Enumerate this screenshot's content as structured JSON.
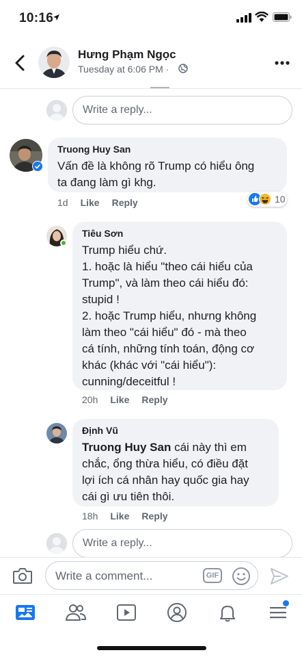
{
  "status": {
    "time": "10:16"
  },
  "header": {
    "name": "Hưng Phạm Ngọc",
    "meta": "Tuesday at 6:06 PM ·"
  },
  "reply_top": {
    "placeholder": "Write a reply..."
  },
  "comments": [
    {
      "name": "Truong Huy San",
      "text": "Vấn đề là không rõ Trump có hiểu ông\nta đang làm gì khg.",
      "time": "1d",
      "like": "Like",
      "reply": "Reply",
      "reaction_count": "10"
    },
    {
      "name": "Tiêu Sơn",
      "text": "Trump hiểu chứ.\n1. hoặc là hiểu \"theo cái hiểu của\nTrump\", và làm theo cái hiểu đó:\nstupid !\n2. hoặc Trump hiểu, nhưng không\nlàm theo \"cái hiểu\" đó - mà theo\ncá tính, những tính toán, động cơ\nkhác (khác với \"cái hiểu\"):\ncunning/deceitful !",
      "time": "20h",
      "like": "Like",
      "reply": "Reply"
    },
    {
      "name": "Định Vũ",
      "mention": "Truong Huy San",
      "text": " cái này thì em\nchắc, ổng thừa hiểu, có điều đặt\nlợi ích cá nhân hay quốc gia hay\ncái gì ưu tiên thôi.",
      "time": "18h",
      "like": "Like",
      "reply": "Reply"
    }
  ],
  "reply_bottom": {
    "placeholder": "Write a reply..."
  },
  "composer": {
    "placeholder": "Write a comment...",
    "gif_label": "GIF"
  },
  "colors": {
    "accent": "#1877f2",
    "bubble": "#f0f2f5",
    "meta": "#606770"
  },
  "icons": [
    "back-arrow-icon",
    "globe-icon",
    "more-icon",
    "camera-icon",
    "emoji-icon",
    "send-icon",
    "news-feed-icon",
    "friends-icon",
    "watch-icon",
    "profile-icon",
    "bell-icon",
    "menu-icon"
  ]
}
